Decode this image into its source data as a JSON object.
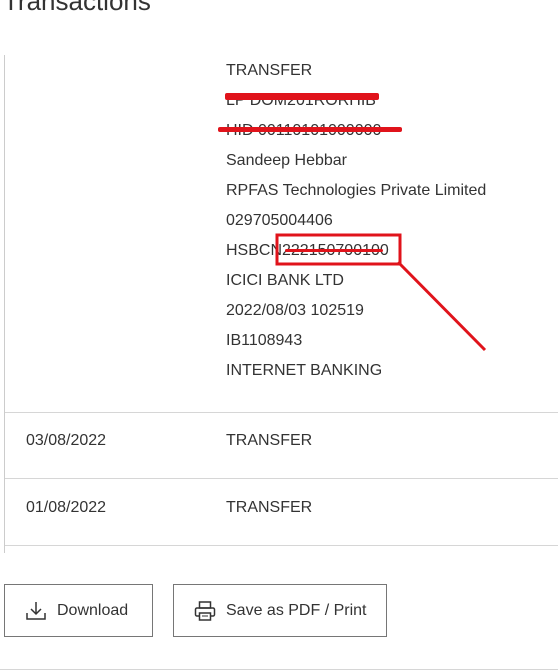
{
  "page": {
    "title": "Transactions"
  },
  "details": {
    "lines": [
      "TRANSFER",
      "LP DOM201RORHIB",
      "HID 00110101000000",
      "Sandeep Hebbar",
      "RPFAS Technologies Private Limited",
      "029705004406",
      "HSBCN222150700100",
      "ICICI BANK LTD",
      "2022/08/03 102519",
      "IB1108943",
      "INTERNET BANKING"
    ]
  },
  "rows": [
    {
      "date": "03/08/2022",
      "description": "TRANSFER"
    },
    {
      "date": "01/08/2022",
      "description": "TRANSFER"
    }
  ],
  "actions": {
    "download_label": "Download",
    "print_label": "Save as PDF / Print"
  },
  "icons": {
    "download": "download-icon",
    "print": "printer-icon"
  },
  "colors": {
    "redaction": "#e0131b",
    "text": "#333333",
    "divider": "#d6d6d6",
    "button_border": "#767676"
  }
}
